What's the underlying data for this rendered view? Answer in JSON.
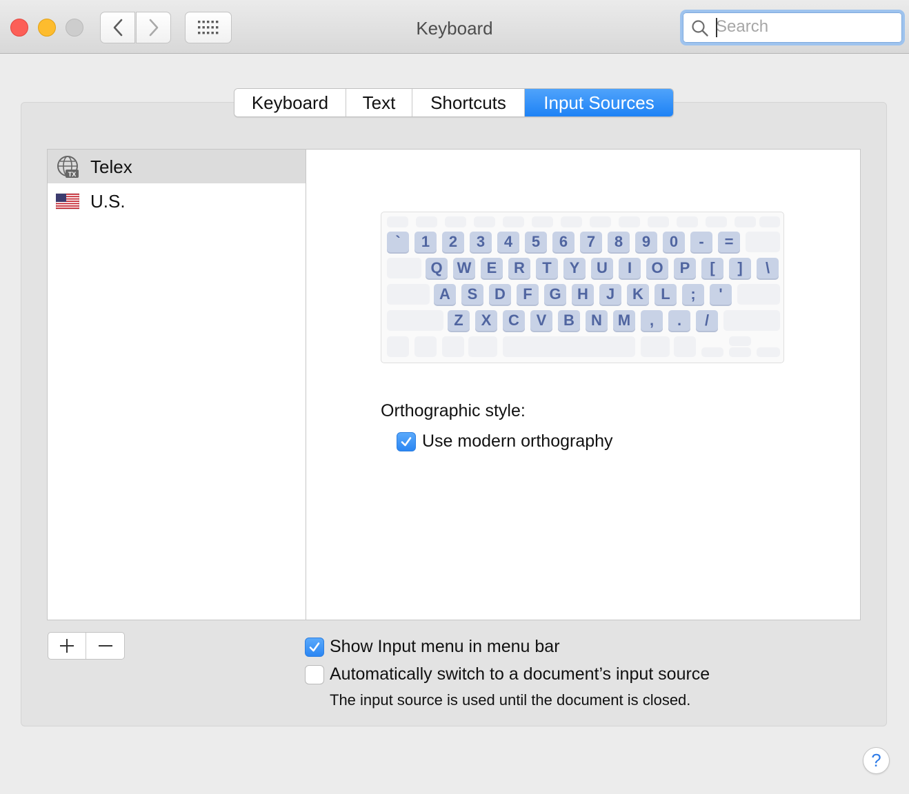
{
  "window": {
    "title": "Keyboard",
    "search_placeholder": "Search"
  },
  "toolbar": {
    "back_icon": "chevron-left-icon",
    "forward_icon": "chevron-right-icon",
    "show_all_icon": "grid-icon"
  },
  "tabs": [
    {
      "label": "Keyboard",
      "active": false
    },
    {
      "label": "Text",
      "active": false
    },
    {
      "label": "Shortcuts",
      "active": false
    },
    {
      "label": "Input Sources",
      "active": true
    }
  ],
  "sources": [
    {
      "label": "Telex",
      "icon": "telex-input-icon",
      "selected": true
    },
    {
      "label": "U.S.",
      "icon": "us-flag-icon",
      "selected": false
    }
  ],
  "keyboard_preview": {
    "row1": [
      "`",
      "1",
      "2",
      "3",
      "4",
      "5",
      "6",
      "7",
      "8",
      "9",
      "0",
      "-",
      "="
    ],
    "row2": [
      "Q",
      "W",
      "E",
      "R",
      "T",
      "Y",
      "U",
      "I",
      "O",
      "P",
      "[",
      "]",
      "\\"
    ],
    "row3": [
      "A",
      "S",
      "D",
      "F",
      "G",
      "H",
      "J",
      "K",
      "L",
      ";",
      "'"
    ],
    "row4": [
      "Z",
      "X",
      "C",
      "V",
      "B",
      "N",
      "M",
      ",",
      ".",
      "/"
    ]
  },
  "detail": {
    "orthographic_label": "Orthographic style:",
    "modern_orthography_label": "Use modern orthography",
    "modern_orthography_checked": true
  },
  "options": {
    "show_input_menu_label": "Show Input menu in menu bar",
    "show_input_menu_checked": true,
    "auto_switch_label": "Automatically switch to a document’s input source",
    "auto_switch_checked": false,
    "auto_switch_note": "The input source is used until the document is closed."
  },
  "buttons": {
    "add_icon": "plus-icon",
    "remove_icon": "minus-icon",
    "help_label": "?"
  },
  "colors": {
    "accent": "#2a86f3",
    "key_label": "#5065a0",
    "key_fill": "#c8d2e6"
  }
}
